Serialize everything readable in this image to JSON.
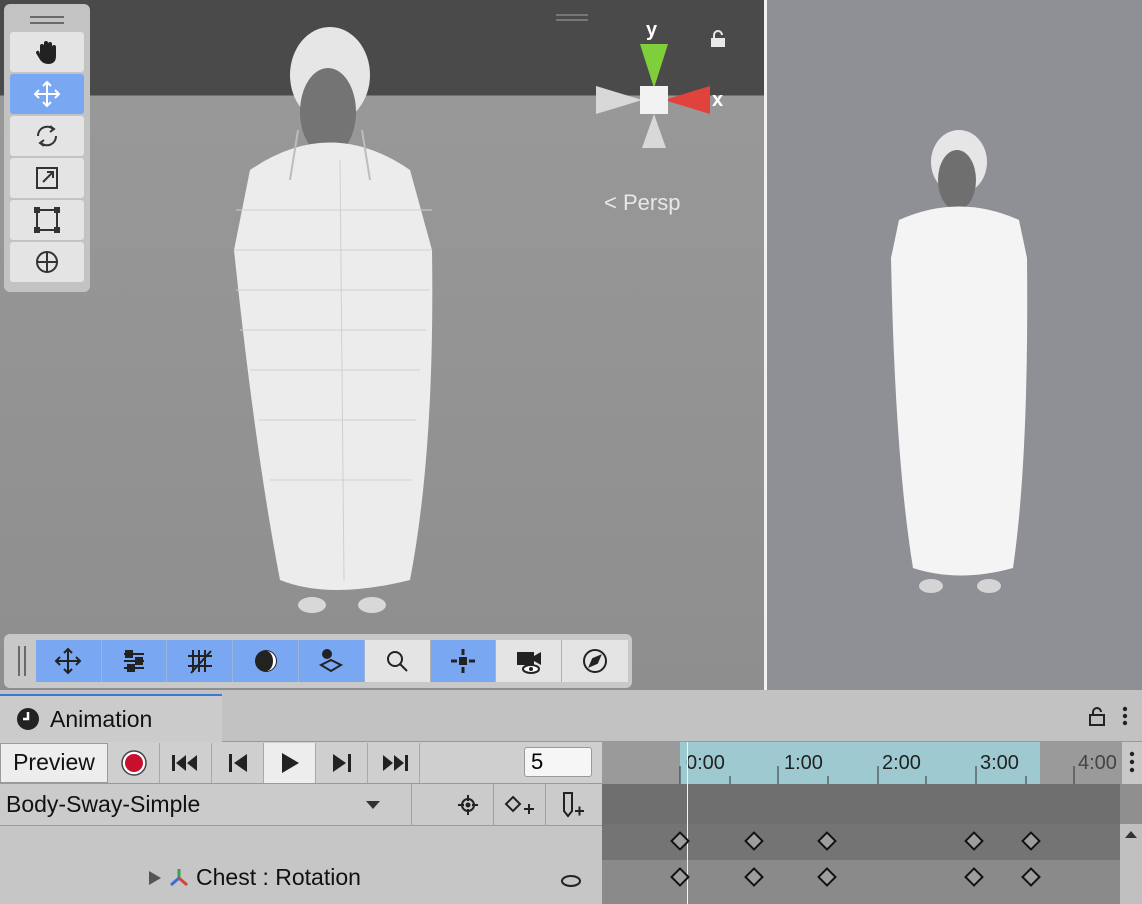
{
  "scene": {
    "persp_label": "Persp",
    "gizmo": {
      "y_label": "y",
      "x_label": "x"
    },
    "tools": [
      "hand-icon",
      "move-icon",
      "rotate-icon",
      "scale-icon",
      "rect-icon",
      "transform-icon"
    ],
    "active_tool": "move-icon",
    "overlay_buttons": [
      {
        "name": "move-tool-button",
        "icon": "move-icon",
        "on": true
      },
      {
        "name": "settings-button",
        "icon": "sliders-icon",
        "on": true
      },
      {
        "name": "grid-button",
        "icon": "grid-icon",
        "on": true
      },
      {
        "name": "shading-button",
        "icon": "shading-icon",
        "on": true
      },
      {
        "name": "layers-button",
        "icon": "layers-icon",
        "on": true
      },
      {
        "name": "search-button",
        "icon": "search-icon",
        "on": false
      },
      {
        "name": "pivot-button",
        "icon": "pivot-icon",
        "on": true
      },
      {
        "name": "camera-button",
        "icon": "camera-icon",
        "on": false
      },
      {
        "name": "navigation-button",
        "icon": "compass-icon",
        "on": false
      }
    ]
  },
  "animation": {
    "tab_title": "Animation",
    "preview_label": "Preview",
    "frame_value": "5",
    "clip_name": "Body-Sway-Simple",
    "property": {
      "object": "Chest",
      "separator": ":",
      "name": "Rotation",
      "label": "Chest : Rotation"
    },
    "ruler_labels": [
      "0:00",
      "1:00",
      "2:00",
      "3:00",
      "4:00"
    ],
    "keyframe_times": [
      "0:00",
      "0:45",
      "1:30",
      "3:00",
      "3:35"
    ]
  },
  "colors": {
    "accent": "#7aa7f2",
    "record": "#c8102e",
    "range": "#9ec9d1"
  }
}
